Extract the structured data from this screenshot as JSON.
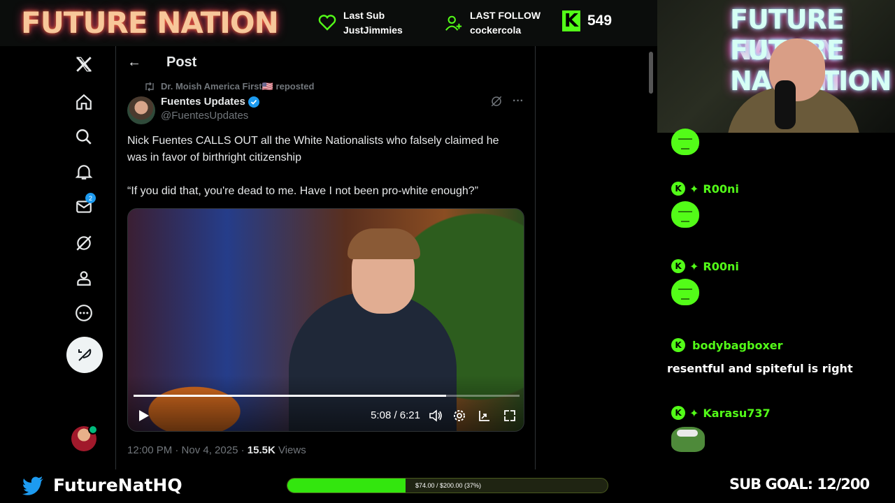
{
  "overlay_top": {
    "brand": "FUTURE NATION",
    "last_sub": {
      "label": "Last Sub",
      "name": "JustJimmies"
    },
    "last_follow": {
      "label": "LAST FOLLOW",
      "name": "cockercola"
    },
    "kick_followers": "549",
    "accent": "#53fc18"
  },
  "nav": {
    "messages_badge": "2",
    "items": [
      "x-logo-icon",
      "home-icon",
      "search-icon",
      "notifications-icon",
      "messages-icon",
      "grok-icon",
      "profile-icon",
      "more-icon"
    ]
  },
  "post": {
    "header_title": "Post",
    "back_glyph": "←",
    "repost_by": "Dr. Moish America First🇺🇸 reposted",
    "author_name": "Fuentes Updates",
    "author_handle": "@FuentesUpdates",
    "body_p1": "Nick Fuentes CALLS OUT all the White Nationalists who falsely claimed he was in favor of birthright citizenship",
    "body_p2": "“If you did that, you're dead to me. Have I not been pro-white enough?”",
    "video": {
      "time": "5:08 / 6:21",
      "progress": 0.81
    },
    "meta_time": "12:00 PM · Nov 4, 2025 ·",
    "meta_views_count": "15.5K",
    "meta_views_label": "Views",
    "more_glyph": "···"
  },
  "stream": {
    "cam_neon": [
      "FUTURE NATION",
      "FUTURE NATION",
      "NATION"
    ],
    "chat": [
      {
        "user": "",
        "type": "emote"
      },
      {
        "user": "R00ni",
        "type": "emote"
      },
      {
        "user": "R00ni",
        "type": "emote"
      },
      {
        "user": "bodybagboxer",
        "text": "resentful and spiteful is right"
      },
      {
        "user": "Karasu737",
        "type": "pepe"
      }
    ]
  },
  "overlay_bottom": {
    "twitter_handle": "FutureNatHQ",
    "goal_text": "$74.00 / $200.00 (37%)",
    "goal_fraction": 0.37,
    "sub_goal": "SUB GOAL: 12/200"
  }
}
